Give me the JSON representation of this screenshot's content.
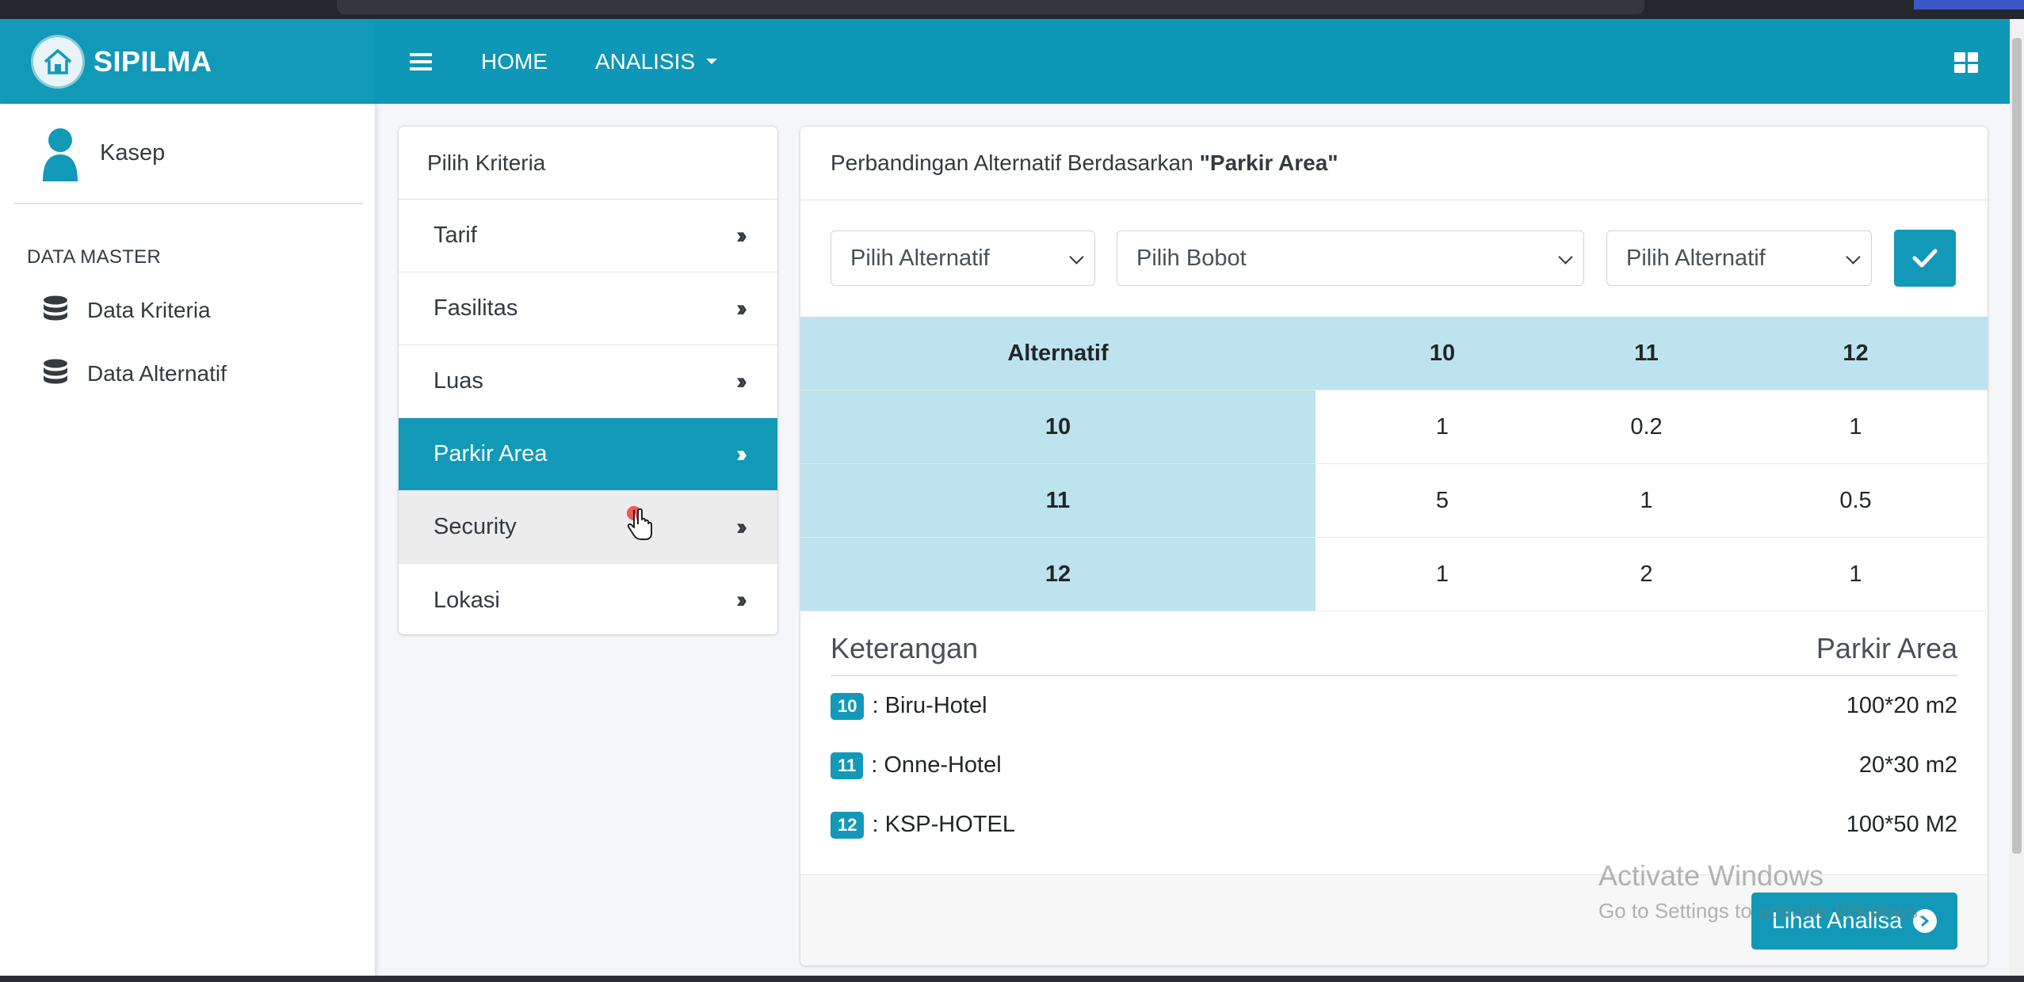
{
  "brand": {
    "name": "SIPILMA"
  },
  "nav": {
    "home": "HOME",
    "analisis": "ANALISIS"
  },
  "sidebar": {
    "user_name": "Kasep",
    "section_header": "DATA MASTER",
    "items": [
      {
        "label": "Data Kriteria",
        "icon": "database-icon"
      },
      {
        "label": "Data Alternatif",
        "icon": "database-icon"
      }
    ]
  },
  "criteria": {
    "header": "Pilih Kriteria",
    "items": [
      {
        "label": "Tarif",
        "chevron": "»"
      },
      {
        "label": "Fasilitas",
        "chevron": "»"
      },
      {
        "label": "Luas",
        "chevron": "»"
      },
      {
        "label": "Parkir Area",
        "chevron": "»"
      },
      {
        "label": "Security",
        "chevron": "»"
      },
      {
        "label": "Lokasi",
        "chevron": "»"
      }
    ],
    "active": "Parkir Area"
  },
  "main": {
    "title_prefix": "Perbandingan Alternatif Berdasarkan",
    "title_criterion": "\"Parkir Area\"",
    "select_alt1": "Pilih Alternatif",
    "select_bobot": "Pilih Bobot",
    "select_alt2": "Pilih Alternatif",
    "table": {
      "headers": [
        "Alternatif",
        "10",
        "11",
        "12"
      ],
      "rows": [
        [
          "10",
          "1",
          "0.2",
          "1"
        ],
        [
          "11",
          "5",
          "1",
          "0.5"
        ],
        [
          "12",
          "1",
          "2",
          "1"
        ]
      ]
    },
    "keterangan": {
      "title": "Keterangan",
      "criterion": "Parkir Area",
      "rows": [
        {
          "id": "10",
          "name": ": Biru-Hotel",
          "value": "100*20 m2"
        },
        {
          "id": "11",
          "name": ": Onne-Hotel",
          "value": "20*30 m2"
        },
        {
          "id": "12",
          "name": ": KSP-HOTEL",
          "value": "100*50 M2"
        }
      ]
    },
    "lihat_button": "Lihat Analisa"
  },
  "watermark": {
    "line1": "Activate Windows",
    "line2": "Go to Settings to activate Windows."
  },
  "colors": {
    "primary": "#1299b8",
    "table_head": "#bde3ee"
  }
}
